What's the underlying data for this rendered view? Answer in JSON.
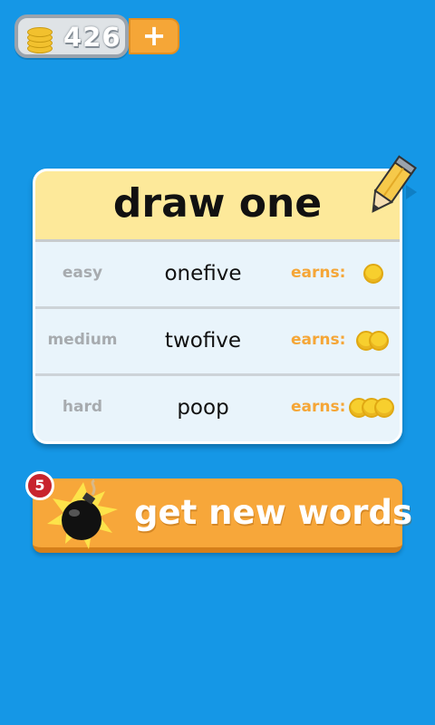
{
  "coins": {
    "count": "426",
    "add_label": "+"
  },
  "card": {
    "title": "draw one",
    "rows": [
      {
        "difficulty": "easy",
        "word": "onefive",
        "earns_label": "earns:",
        "coin_reward": 1
      },
      {
        "difficulty": "medium",
        "word": "twofive",
        "earns_label": "earns:",
        "coin_reward": 2
      },
      {
        "difficulty": "hard",
        "word": "poop",
        "earns_label": "earns:",
        "coin_reward": 3
      }
    ]
  },
  "new_words_button": {
    "label": "get new words",
    "bomb_count": "5",
    "icon": "bomb-icon"
  },
  "colors": {
    "background": "#1597e6",
    "accent": "#f7a73a",
    "header": "#fde99a",
    "coin": "#f7cf2e",
    "badge": "#c8242d"
  }
}
